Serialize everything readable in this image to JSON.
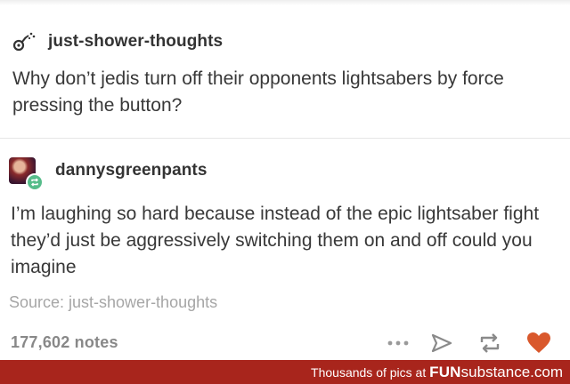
{
  "original_post": {
    "username": "just-shower-thoughts",
    "text": "Why don’t jedis turn off their opponents lightsabers by force pressing the button?",
    "icon": "shower-head-icon"
  },
  "reblog": {
    "username": "dannysgreenpants",
    "text": "I’m laughing so hard because instead of the epic lightsaber fight they’d just be aggressively switching them on and off could you imagine",
    "avatar_icon": "avatar",
    "badge_icon": "reblog-icon"
  },
  "source_label": "Source: just-shower-thoughts",
  "notes": "177,602 notes",
  "actions": {
    "more_icon": "more-icon",
    "share_icon": "share-icon",
    "reblog_icon": "reblog-icon",
    "like_icon": "heart-icon"
  },
  "watermark": {
    "prefix": "Thousands of pics at ",
    "brand_bold": "FUN",
    "brand_rest": "substance",
    "domain_suffix": ".com"
  },
  "colors": {
    "reblog_badge": "#56bc8a",
    "heart": "#d9582c",
    "watermark_bg": "#a8251c",
    "text": "#383838",
    "muted": "#a6a6a6"
  }
}
